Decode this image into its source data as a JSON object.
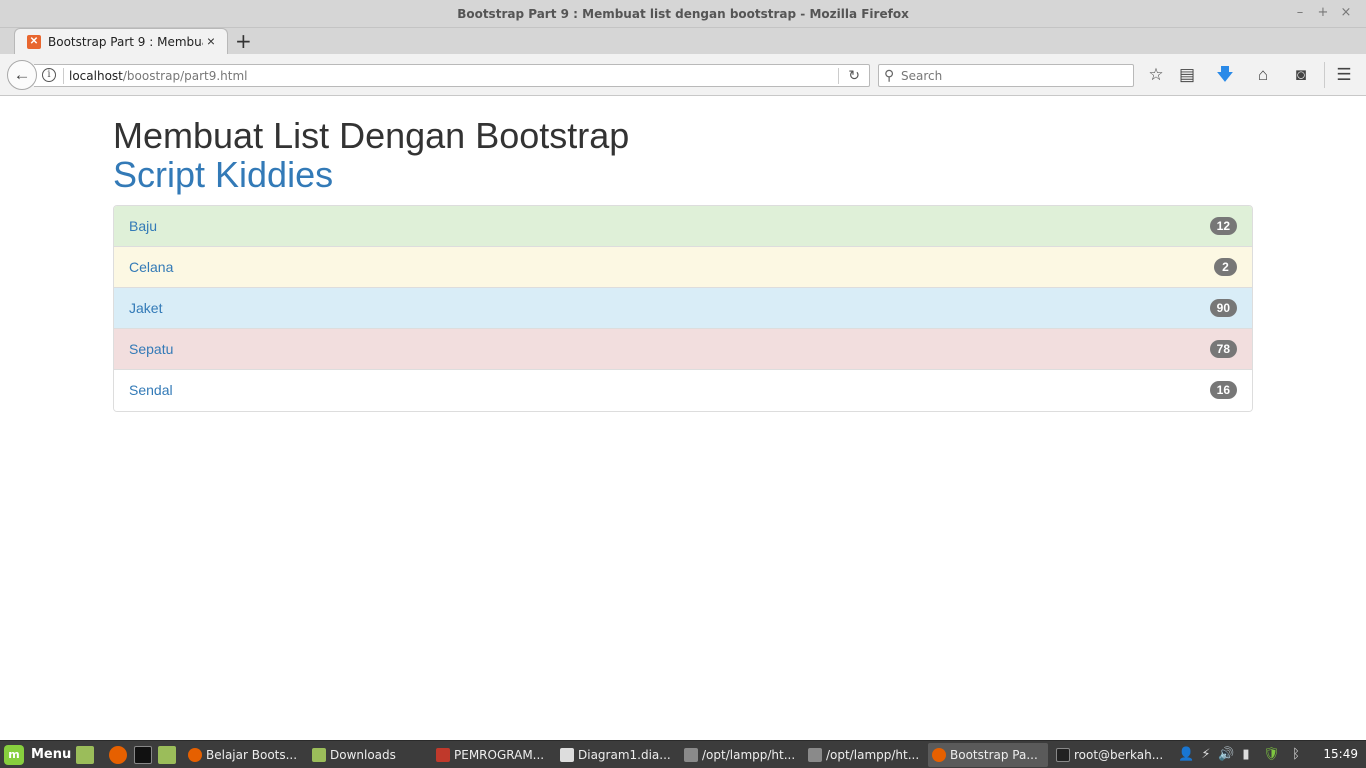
{
  "window": {
    "title": "Bootstrap Part 9 : Membuat list dengan bootstrap - Mozilla Firefox",
    "controls": {
      "minimize": "–",
      "maximize": "+",
      "close": "×"
    }
  },
  "tab": {
    "label": "Bootstrap Part 9 : Membuat list dengan bootstrap",
    "close": "×",
    "new_tab": "+"
  },
  "toolbar": {
    "url_host": "localhost",
    "url_path": "/boostrap/part9.html",
    "search_placeholder": "Search"
  },
  "icons": {
    "back": "back-arrow-icon",
    "info": "info-icon",
    "reload": "reload-icon",
    "search": "search-icon",
    "bookmark": "star-icon",
    "reading_list": "clipboard-icon",
    "downloads": "download-arrow-icon",
    "home": "home-icon",
    "pocket": "pocket-icon",
    "menu": "hamburger-icon"
  },
  "page": {
    "title": "Membuat List Dengan Bootstrap",
    "subtitle": "Script Kiddies",
    "list": [
      {
        "label": "Baju",
        "badge": "12",
        "bg": "#dff0d8"
      },
      {
        "label": "Celana",
        "badge": "2",
        "bg": "#fcf8e3"
      },
      {
        "label": "Jaket",
        "badge": "90",
        "bg": "#d9edf7"
      },
      {
        "label": "Sepatu",
        "badge": "78",
        "bg": "#f2dede"
      },
      {
        "label": "Sendal",
        "badge": "16",
        "bg": "#ffffff"
      }
    ]
  },
  "taskbar": {
    "menu_label": "Menu",
    "tasks": [
      {
        "label": "Belajar Boots...",
        "active": false,
        "color": "#e66000"
      },
      {
        "label": "Downloads",
        "active": false,
        "color": "#9bbd5a"
      },
      {
        "label": "PEMROGRAM...",
        "active": false,
        "color": "#c0392b"
      },
      {
        "label": "Diagram1.dia...",
        "active": false,
        "color": "#dddddd"
      },
      {
        "label": "/opt/lampp/ht...",
        "active": false,
        "color": "#8a8a8a"
      },
      {
        "label": "/opt/lampp/ht...",
        "active": false,
        "color": "#8a8a8a"
      },
      {
        "label": "Bootstrap Pa...",
        "active": true,
        "color": "#e66000"
      },
      {
        "label": "root@berkah...",
        "active": false,
        "color": "#222222"
      }
    ],
    "clock": "15:49"
  }
}
